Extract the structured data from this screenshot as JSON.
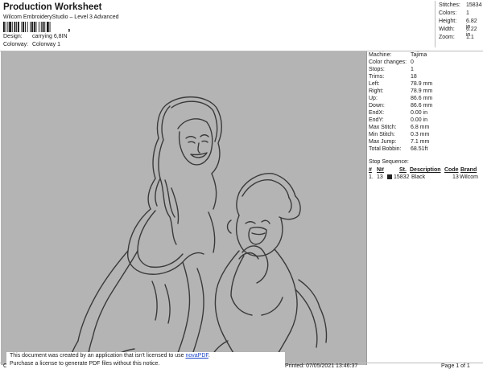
{
  "header": {
    "title": "Production Worksheet",
    "subtitle": "Wilcom EmbroideryStudio – Level 3 Advanced",
    "barcode_suffix": ",",
    "design_label": "Design:",
    "design_value": "carrying 6,8IN",
    "colorway_label": "Colorway:",
    "colorway_value": "Colorway 1"
  },
  "stats": [
    {
      "key": "Stitches:",
      "value": "15834"
    },
    {
      "key": "Colors:",
      "value": "1"
    },
    {
      "key": "Height:",
      "value": "6.82 in"
    },
    {
      "key": "Width:",
      "value": "6.22 in"
    },
    {
      "key": "Zoom:",
      "value": "1:1"
    }
  ],
  "info": [
    {
      "key": "Machine:",
      "value": "Tajima"
    },
    {
      "key": "Color changes:",
      "value": "0"
    },
    {
      "key": "Stops:",
      "value": "1"
    },
    {
      "key": "Trims:",
      "value": "18"
    },
    {
      "key": "Left:",
      "value": "78.9 mm"
    },
    {
      "key": "Right:",
      "value": "78.9 mm"
    },
    {
      "key": "Up:",
      "value": "86.6 mm"
    },
    {
      "key": "Down:",
      "value": "86.6 mm"
    },
    {
      "key": "EndX:",
      "value": "0.00 in"
    },
    {
      "key": "EndY:",
      "value": "0.00 in"
    },
    {
      "key": "Max Stitch:",
      "value": "6.8 mm"
    },
    {
      "key": "Min Stitch:",
      "value": "0.3 mm"
    },
    {
      "key": "Max Jump:",
      "value": "7.1 mm"
    },
    {
      "key": "Total Bobbin:",
      "value": "68.51ft"
    }
  ],
  "stop_sequence": {
    "label": "Stop Sequence:",
    "headers": [
      "#",
      "N#",
      "St.",
      "Description",
      "Code",
      "Brand"
    ],
    "rows": [
      {
        "num": "1.",
        "n": "13",
        "st": "15832",
        "description": "Black",
        "code": "13",
        "brand": "Wilcom",
        "swatch_color": "#222222"
      }
    ]
  },
  "notice": {
    "line1_pre": "This document was created by an application that isn't licensed to use ",
    "link": "novaPDF",
    "line1_post": ".",
    "line2": "Purchase a license to generate PDF files without this notice."
  },
  "footer": {
    "left": "Cr",
    "printed": "Printed: 07/05/2021 13:46:37",
    "page": "Page 1 of 1"
  },
  "colors": {
    "canvas_bg": "#b4b4b4",
    "outline": "#3a3a3a",
    "link": "#1a44c8"
  }
}
